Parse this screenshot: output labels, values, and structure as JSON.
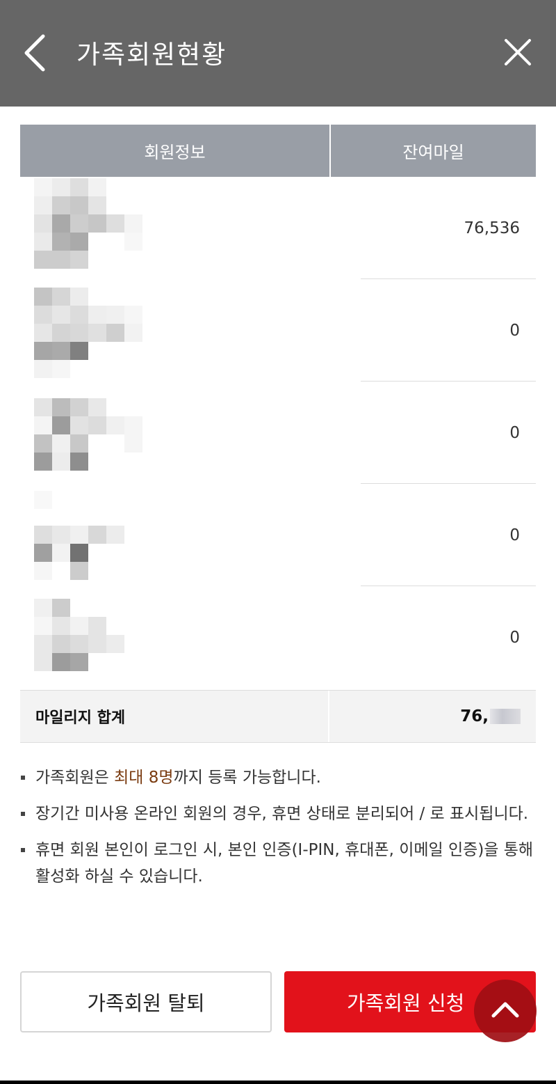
{
  "header": {
    "title": "가족회원현황",
    "back_icon": "chevron-left-icon",
    "close_icon": "close-icon"
  },
  "table": {
    "col_member_info": "회원정보",
    "col_remaining_mileage": "잔여마일",
    "rows": [
      {
        "value": "76,536"
      },
      {
        "value": "0"
      },
      {
        "value": "0"
      },
      {
        "value": "0"
      },
      {
        "value": "0"
      }
    ],
    "total_label": "마일리지 합계",
    "total_value_visible": "76,"
  },
  "notes": {
    "note1_before": "가족회원은 ",
    "note1_highlight": "최대 8명",
    "note1_after": "까지 등록 가능합니다.",
    "note2": "장기간 미사용 온라인 회원의 경우, 휴면 상태로 분리되어 / 로 표시됩니다.",
    "note3": "휴면 회원 본인이 로그인 시, 본인 인증(I-PIN, 휴대폰, 이메일 인증)을 통해 활성화 하실 수 있습니다."
  },
  "buttons": {
    "leave": "가족회원 탈퇴",
    "apply": "가족회원 신청",
    "scroll_top_icon": "chevron-up-icon"
  },
  "colors": {
    "header_bg": "#666666",
    "table_head_bg": "#999ea6",
    "accent_red": "#e2121b",
    "highlight_brown": "#7a3b10"
  }
}
